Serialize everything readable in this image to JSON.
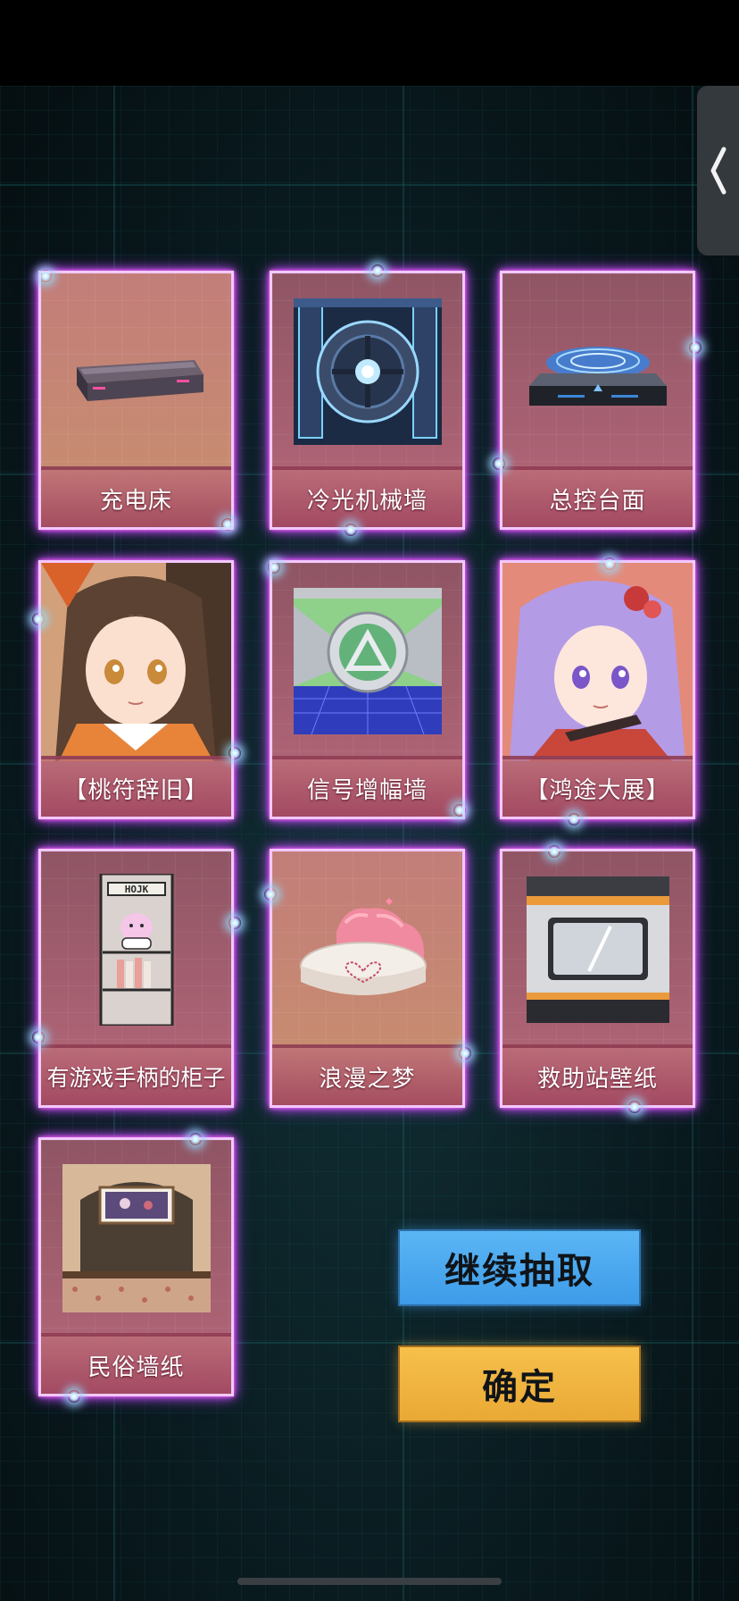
{
  "cards": [
    {
      "label": "充电床",
      "art": "charging-bed",
      "bg": "tan",
      "glow": true
    },
    {
      "label": "冷光机械墙",
      "art": "mech-wall",
      "bg": "pink",
      "glow": true
    },
    {
      "label": "总控台面",
      "art": "control-console",
      "bg": "pink",
      "glow": true
    },
    {
      "label": "【桃符辞旧】",
      "art": "girl-brown-hair",
      "bg": "pink",
      "glow": true
    },
    {
      "label": "信号增幅墙",
      "art": "signal-wall",
      "bg": "pink",
      "glow": true
    },
    {
      "label": "【鸿途大展】",
      "art": "girl-purple-hair",
      "bg": "pink",
      "glow": true
    },
    {
      "label": "有游戏手柄的柜子",
      "art": "game-cabinet",
      "bg": "pink",
      "glow": true
    },
    {
      "label": "浪漫之梦",
      "art": "romantic-bed",
      "bg": "tan",
      "glow": true
    },
    {
      "label": "救助站壁纸",
      "art": "rescue-wallpaper",
      "bg": "pink",
      "glow": true
    },
    {
      "label": "民俗墙纸",
      "art": "folk-wallpaper",
      "bg": "pink",
      "glow": true
    }
  ],
  "buttons": {
    "continue_label": "继续抽取",
    "confirm_label": "确定"
  },
  "colors": {
    "continue_button": "#4aa8ef",
    "confirm_button": "#f0b640",
    "glow": "#d84dff",
    "background": "#0a1a1e"
  },
  "icons": {
    "back": "chevron-left-icon"
  }
}
